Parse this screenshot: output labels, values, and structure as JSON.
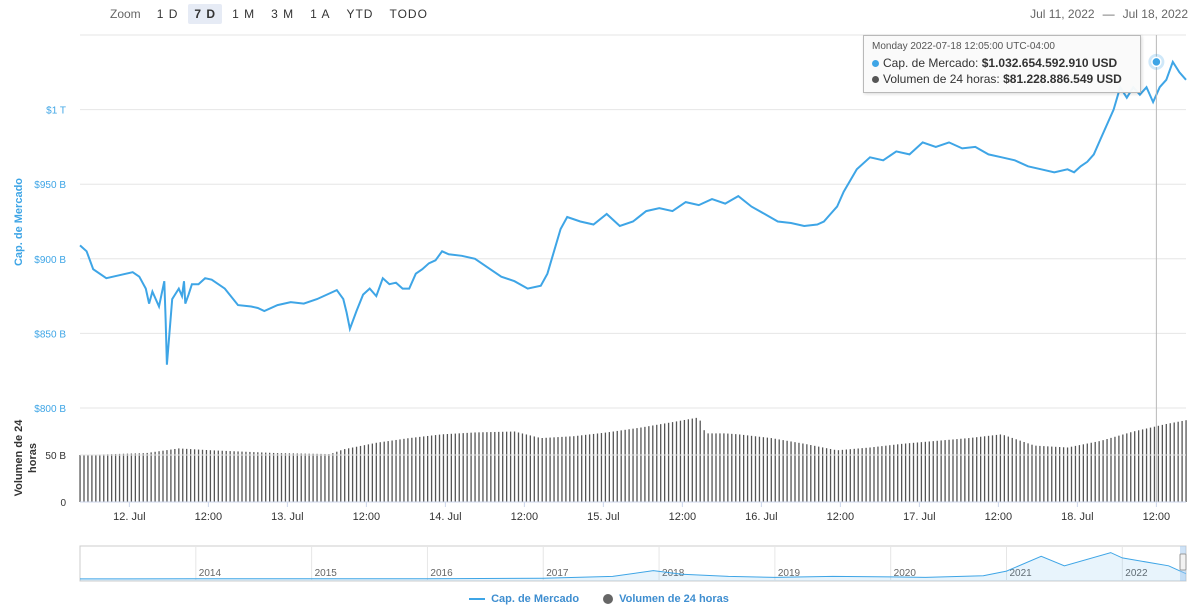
{
  "zoom": {
    "label": "Zoom",
    "buttons": [
      {
        "label": "1 D",
        "active": false
      },
      {
        "label": "7 D",
        "active": true
      },
      {
        "label": "1 M",
        "active": false
      },
      {
        "label": "3 M",
        "active": false
      },
      {
        "label": "1 A",
        "active": false
      },
      {
        "label": "YTD",
        "active": false
      },
      {
        "label": "TODO",
        "active": false
      }
    ]
  },
  "range": {
    "from": "Jul 11, 2022",
    "separator": "—",
    "to": "Jul 18, 2022"
  },
  "tooltip": {
    "header": "Monday 2022-07-18 12:05:00 UTC-04:00",
    "market_cap_label": "Cap. de Mercado:",
    "market_cap_value": "$1.032.654.592.910 USD",
    "volume_label": "Volumen de 24 horas:",
    "volume_value": "$81.228.886.549 USD"
  },
  "legend": {
    "market_cap": "Cap. de Mercado",
    "volume": "Volumen de 24 horas"
  },
  "colors": {
    "market_cap": "#3ea5e6",
    "volume": "#5a5a5a",
    "accent": "#3ea5e6"
  },
  "chart_data": [
    {
      "type": "line",
      "title": "",
      "ylabel": "Cap. de Mercado",
      "ylim": [
        800,
        1050
      ],
      "yticks": [
        {
          "v": 850,
          "label": "$850 B"
        },
        {
          "v": 900,
          "label": "$900 B"
        },
        {
          "v": 950,
          "label": "$950 B"
        },
        {
          "v": 1000,
          "label": "$1 T"
        }
      ],
      "xlim": [
        0,
        168
      ],
      "xticks": [
        {
          "v": 7.5,
          "label": "12. Jul"
        },
        {
          "v": 19.5,
          "label": "12:00"
        },
        {
          "v": 31.5,
          "label": "13. Jul"
        },
        {
          "v": 43.5,
          "label": "12:00"
        },
        {
          "v": 55.5,
          "label": "14. Jul"
        },
        {
          "v": 67.5,
          "label": "12:00"
        },
        {
          "v": 79.5,
          "label": "15. Jul"
        },
        {
          "v": 91.5,
          "label": "12:00"
        },
        {
          "v": 103.5,
          "label": "16. Jul"
        },
        {
          "v": 115.5,
          "label": "12:00"
        },
        {
          "v": 127.5,
          "label": "17. Jul"
        },
        {
          "v": 139.5,
          "label": "12:00"
        },
        {
          "v": 151.5,
          "label": "18. Jul"
        },
        {
          "v": 163.5,
          "label": "12:00"
        }
      ],
      "grid": true,
      "x": [
        0,
        1,
        2,
        4,
        6,
        8,
        9,
        10,
        10.5,
        11,
        12,
        12.8,
        13,
        13.2,
        14,
        15,
        15.5,
        15.8,
        16,
        16.5,
        17,
        18,
        19,
        20,
        22,
        24,
        26,
        27,
        28,
        30,
        32,
        34,
        36,
        38,
        39,
        40,
        40.5,
        41,
        42,
        43,
        44,
        45,
        46,
        47,
        48,
        49,
        50,
        51,
        52,
        53,
        54,
        55,
        56,
        58,
        60,
        62,
        64,
        66,
        68,
        70,
        71,
        72,
        73,
        74,
        76,
        78,
        80,
        82,
        84,
        86,
        88,
        90,
        92,
        94,
        96,
        98,
        100,
        102,
        104,
        106,
        108,
        110,
        112,
        113,
        114,
        115,
        116,
        118,
        120,
        122,
        124,
        126,
        128,
        130,
        132,
        134,
        136,
        138,
        140,
        142,
        144,
        146,
        148,
        150,
        151,
        152,
        153,
        154,
        155,
        156,
        157,
        158,
        159,
        160,
        161,
        162,
        163,
        163.5,
        164,
        165,
        166,
        167,
        168
      ],
      "series": [
        {
          "name": "Cap. de Mercado",
          "values": [
            909,
            905,
            893,
            887,
            889,
            891,
            888,
            880,
            870,
            878,
            868,
            885,
            860,
            829,
            873,
            880,
            875,
            885,
            870,
            876,
            883,
            883,
            887,
            886,
            880,
            869,
            868,
            867,
            865,
            869,
            871,
            870,
            873,
            877,
            879,
            873,
            864,
            853,
            865,
            876,
            880,
            875,
            887,
            883,
            884,
            880,
            880,
            890,
            893,
            897,
            899,
            905,
            903,
            902,
            900,
            894,
            888,
            885,
            880,
            882,
            890,
            905,
            920,
            928,
            925,
            923,
            930,
            922,
            925,
            932,
            934,
            932,
            938,
            936,
            940,
            937,
            942,
            935,
            930,
            925,
            924,
            922,
            923,
            925,
            930,
            935,
            945,
            960,
            968,
            966,
            972,
            970,
            978,
            975,
            978,
            974,
            975,
            970,
            968,
            966,
            962,
            960,
            958,
            960,
            958,
            962,
            965,
            970,
            980,
            990,
            1000,
            1015,
            1008,
            1015,
            1010,
            1015,
            1005,
            1010,
            1015,
            1020,
            1032,
            1025,
            1020,
            1000,
            998,
            995,
            997
          ]
        }
      ]
    },
    {
      "type": "bar",
      "title": "",
      "ylabel": "Volumen de 24 horas",
      "ylim": [
        0,
        100
      ],
      "yticks": [
        {
          "v": 0,
          "label": "0"
        },
        {
          "v": 50,
          "label": "50 B"
        }
      ],
      "x": [
        0,
        10,
        15,
        20,
        30,
        38,
        40,
        45,
        50,
        55,
        60,
        66,
        70,
        75,
        80,
        85,
        90,
        94,
        95,
        98,
        100,
        105,
        110,
        115,
        120,
        125,
        130,
        135,
        140,
        145,
        150,
        155,
        160,
        165,
        168
      ],
      "series": [
        {
          "name": "Volumen de 24 horas",
          "values": [
            50,
            52,
            57,
            55,
            52,
            51,
            56,
            63,
            68,
            72,
            74,
            75,
            68,
            70,
            74,
            79,
            85,
            90,
            73,
            73,
            72,
            68,
            62,
            55,
            58,
            62,
            65,
            68,
            72,
            60,
            58,
            65,
            75,
            83,
            87
          ]
        }
      ]
    },
    {
      "type": "area",
      "title": "",
      "xticks": [
        "2014",
        "2015",
        "2016",
        "2017",
        "2018",
        "2019",
        "2020",
        "2021",
        "2022"
      ],
      "x": [
        2013.0,
        2014,
        2015,
        2016,
        2017,
        2017.6,
        2017.95,
        2018.2,
        2018.6,
        2019,
        2019.5,
        2020,
        2020.3,
        2020.8,
        2021.0,
        2021.3,
        2021.5,
        2021.9,
        2022.0,
        2022.4,
        2022.55
      ],
      "values": [
        0.2,
        0.6,
        0.3,
        0.5,
        1.5,
        5,
        16,
        9,
        5,
        3,
        5,
        4,
        3,
        6,
        15,
        43,
        25,
        50,
        40,
        25,
        10
      ]
    }
  ]
}
